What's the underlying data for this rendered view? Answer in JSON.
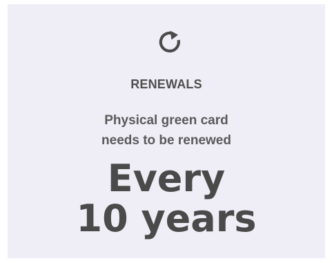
{
  "card": {
    "icon": "refresh-icon",
    "heading": "RENEWALS",
    "description_lines": [
      "Physical green card",
      "needs to be renewed"
    ],
    "value_lines": [
      "Every",
      "10 years"
    ],
    "colors": {
      "background": "#efedf6",
      "text": "#4a4a4a"
    }
  }
}
